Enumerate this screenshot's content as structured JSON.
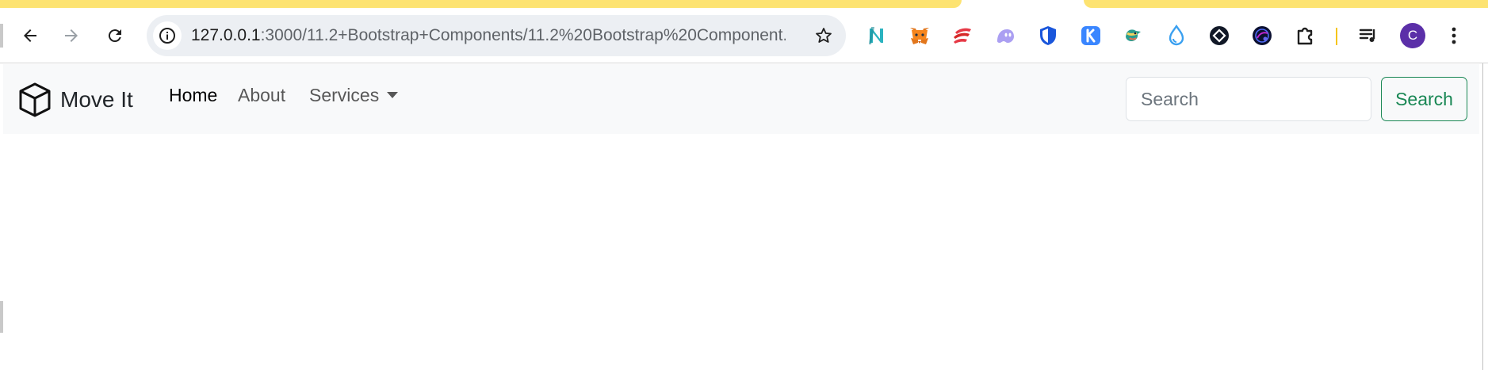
{
  "browser": {
    "url_host": "127.0.0.1",
    "url_rest": ":3000/11.2+Bootstrap+Components/11.2%20Bootstrap%20Component...",
    "avatar_letter": "C",
    "extensions": [
      "n-logo-icon",
      "metamask-fox-icon",
      "red-stack-icon",
      "purple-ghost-icon",
      "blue-shield-icon",
      "k-badge-icon",
      "colorful-bird-icon",
      "water-drop-icon",
      "diamond-circle-icon",
      "dark-globe-icon",
      "puzzle-icon",
      "media-queue-icon"
    ],
    "colors": {
      "tab_yellow": "#fde372",
      "omnibox_bg": "#eceff3",
      "avatar_bg": "#5b2fa8"
    }
  },
  "navbar": {
    "brand": "Move It",
    "links": [
      "Home",
      "About",
      "Services"
    ],
    "active_link": "Home",
    "search_placeholder": "Search",
    "search_button": "Search",
    "colors": {
      "bg": "#f8f9fa",
      "success": "#198754"
    }
  }
}
